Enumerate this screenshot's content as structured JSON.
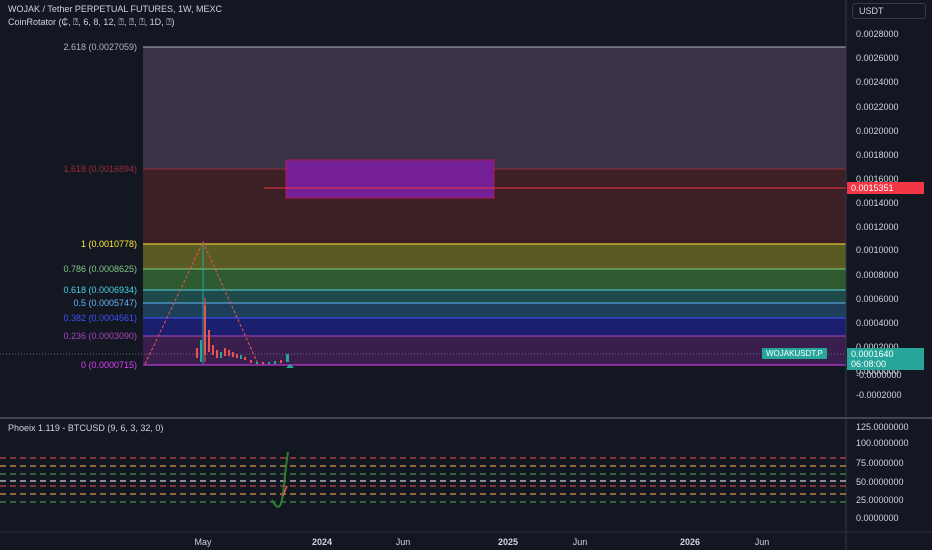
{
  "header": {
    "title": "WOJAK / Tether PERPETUAL FUTURES, 1W, MEXC",
    "indicator": "CoinRotator (₵, ⍰, 6, 8, 12, ⍰, ⍰, ⍰, 1D, ⍰)",
    "lower_indicator": "Phoeix 1.119 - BTCUSD (9, 6, 3, 32, 0)"
  },
  "currency_button": "USDT",
  "fib_levels": [
    {
      "label": "2.618 (0.0027059)",
      "color": "#b2b5be"
    },
    {
      "label": "1.618 (0.0016894)",
      "color": "#f23645"
    },
    {
      "label": "1 (0.0010778)",
      "color": "#ffeb3b"
    },
    {
      "label": "0.786 (0.0008625)",
      "color": "#81c784"
    },
    {
      "label": "0.618 (0.0006934)",
      "color": "#4dd0e1"
    },
    {
      "label": "0.5 (0.0005747)",
      "color": "#64b5f6"
    },
    {
      "label": "0.382 (0.0004561)",
      "color": "#3f51ff"
    },
    {
      "label": "0.236 (0.0003090)",
      "color": "#ab47bc"
    },
    {
      "label": "0 (0.0000715)",
      "color": "#e040fb"
    }
  ],
  "price_axis": [
    "0.0028000",
    "0.0026000",
    "0.0024000",
    "0.0022000",
    "0.0020000",
    "0.0018000",
    "0.0016000",
    "0.0014000",
    "0.0012000",
    "0.0010000",
    "0.0008000",
    "0.0006000",
    "0.0004000",
    "0.0002000",
    "0.0000000",
    "-0.0000000",
    "-0.0002000"
  ],
  "osc_axis": [
    "125.0000000",
    "100.0000000",
    "75.0000000",
    "50.0000000",
    "25.0000000",
    "0.0000000"
  ],
  "time_axis": [
    "May",
    "2024",
    "Jun",
    "2025",
    "Jun",
    "2026",
    "Jun"
  ],
  "tags": {
    "red_price": "0.0015351",
    "symbol": "WOJAKUSDT.P",
    "last_price": "0.0001640",
    "countdown": "06:08:00"
  }
}
